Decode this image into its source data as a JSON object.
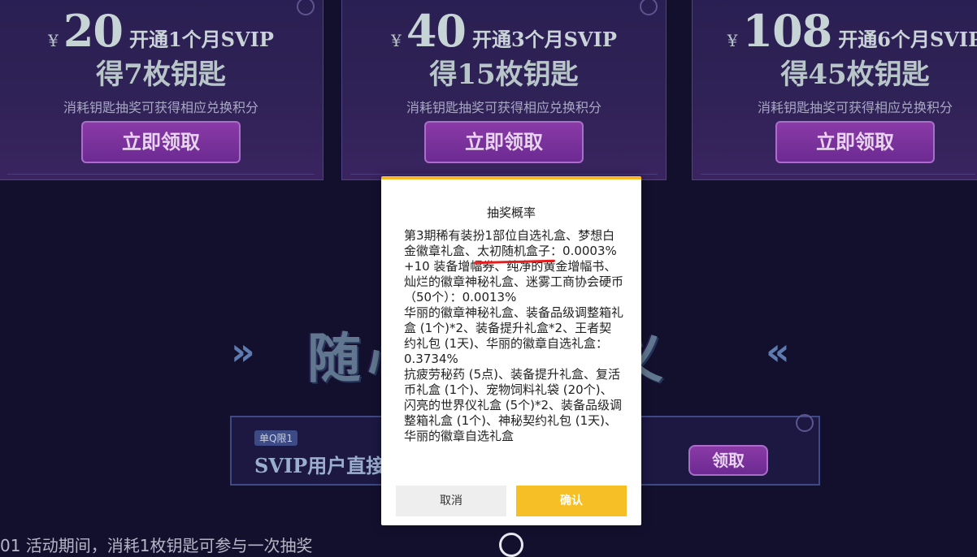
{
  "cards": [
    {
      "currency": "¥",
      "price": "20",
      "plan": "开通1个月SVIP",
      "keys": "得7枚钥匙",
      "tip": "消耗钥匙抽奖可获得相应兑换积分",
      "claim": "立即领取"
    },
    {
      "currency": "¥",
      "price": "40",
      "plan": "开通3个月SVIP",
      "keys": "得15枚钥匙",
      "tip": "消耗钥匙抽奖可获得相应兑换积分",
      "claim": "立即领取"
    },
    {
      "currency": "¥",
      "price": "108",
      "plan": "开通6个月SVIP",
      "keys": "得45枚钥匙",
      "tip": "消耗钥匙抽奖可获得相应兑换积分",
      "claim": "立即领取"
    }
  ],
  "slogan": {
    "left": "随心",
    "right": "定义"
  },
  "task": {
    "limit_badge": "单Q限1",
    "description": "SVIP用户直接",
    "collect": "领取"
  },
  "footnote": "01 活动期间，消耗1枚钥匙可参与一次抽奖",
  "dialog": {
    "title": "抽奖概率",
    "lines": [
      "第3期稀有装扮1部位自选礼盒、梦想白金徽章礼盒、",
      "太初随机盒子",
      "：0.0003%",
      "+10 装备增幅券、纯净的黄金增幅书、灿烂的徽章神秘礼盒、迷雾工商协会硬币（50个）：0.0013%",
      "华丽的徽章神秘礼盒、装备品级调整箱礼盒 (1个)*2、装备提升礼盒*2、王者契约礼包 (1天)、华丽的徽章自选礼盒：0.3734%",
      "抗疲劳秘药 (5点)、装备提升礼盒、复活币礼盒 (1个)、宠物饲料礼袋 (20个)、闪亮的世界仪礼盒 (5个)*2、装备品级调整箱礼盒 (1个)、神秘契约礼包 (1天)、华丽的徽章自选礼盒"
    ],
    "cancel": "取消",
    "confirm": "确认"
  }
}
